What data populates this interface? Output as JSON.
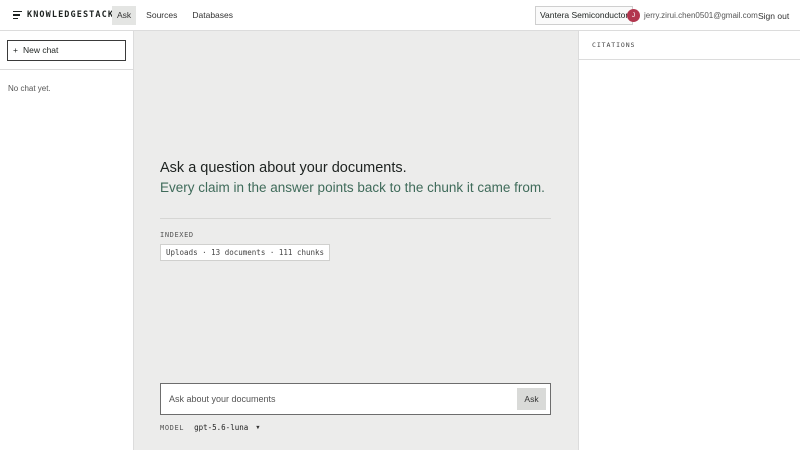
{
  "header": {
    "brand": "KNOWLEDGESTACK",
    "brand_icon": "menu-lines-icon",
    "tabs": [
      {
        "label": "Ask",
        "active": true
      },
      {
        "label": "Sources",
        "active": false
      },
      {
        "label": "Databases",
        "active": false
      }
    ],
    "org": "Vantera Semiconductor",
    "avatar_initial": "J",
    "avatar_color": "#b2364e",
    "user_email": "jerry.zirui.chen0501@gmail.com",
    "sign_out": "Sign out"
  },
  "sidebar": {
    "new_chat_icon": "+",
    "new_chat_label": "New chat",
    "empty_text": "No chat yet."
  },
  "main": {
    "headline": "Ask a question about your documents.",
    "subline": "Every claim in the answer points back to the chunk it came from.",
    "indexed_label": "INDEXED",
    "indexed_summary": "Uploads · 13 documents · 111 chunks",
    "accent_color": "#3f6b5a",
    "ask_placeholder": "Ask about your documents",
    "ask_button": "Ask",
    "model_label": "MODEL",
    "model_value": "gpt-5.6-luna",
    "model_caret": "▼"
  },
  "citations": {
    "title": "CITATIONS"
  }
}
